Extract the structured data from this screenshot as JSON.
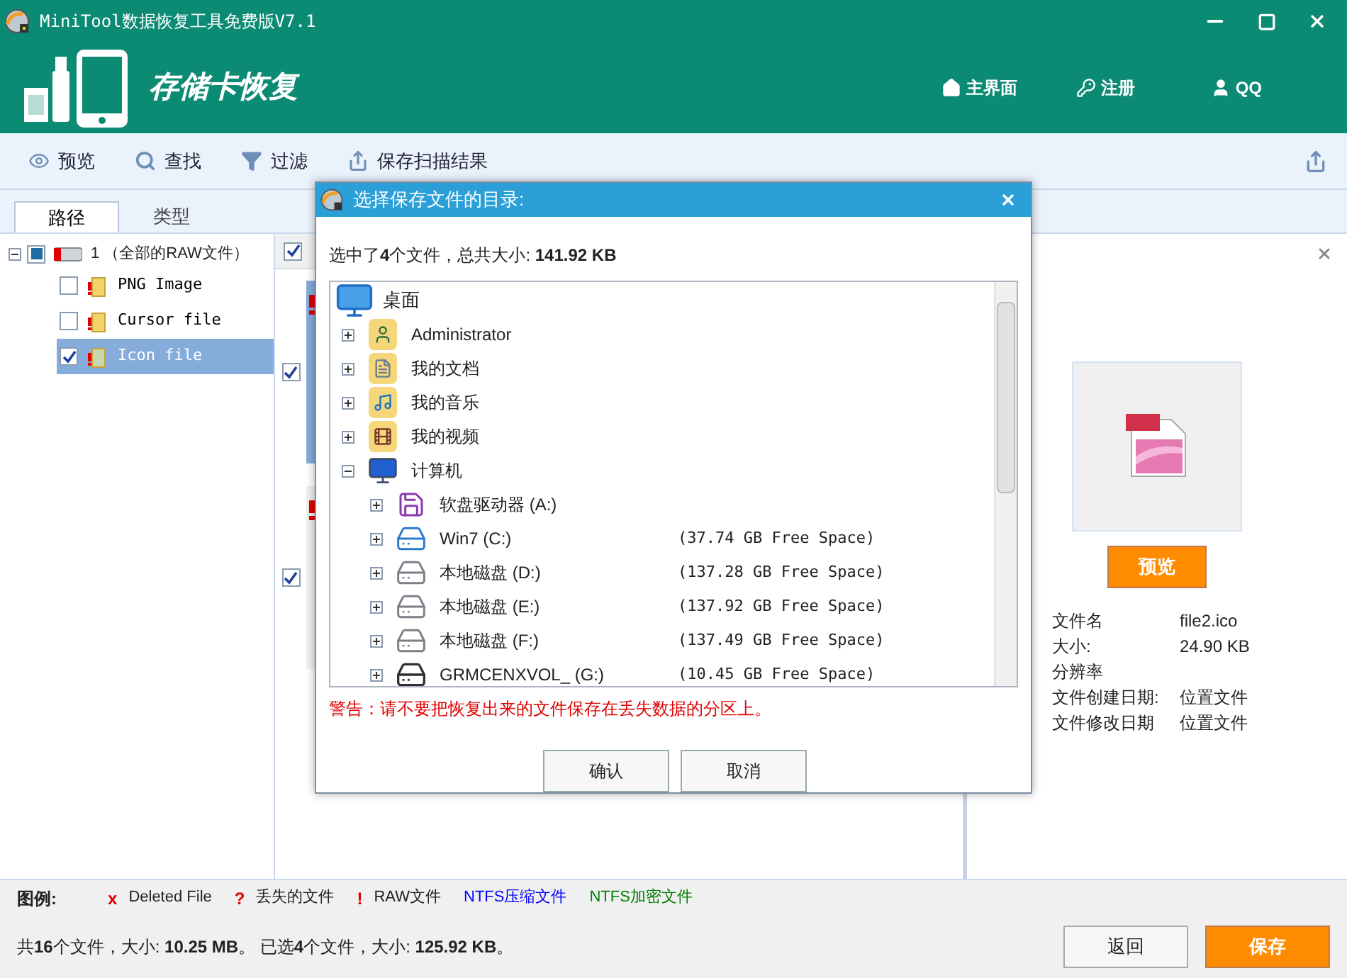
{
  "window": {
    "title": "MiniTool数据恢复工具免费版V7.1"
  },
  "header": {
    "title": "存储卡恢复",
    "nav": [
      "主界面",
      "注册",
      "QQ"
    ]
  },
  "toolbar": {
    "items": [
      "预览",
      "查找",
      "过滤",
      "保存扫描结果"
    ]
  },
  "tabs": [
    {
      "label": "路径",
      "selected": true
    },
    {
      "label": "类型",
      "selected": false
    }
  ],
  "tree": {
    "label": "1 （全部的RAW文件）",
    "expanded": true,
    "checked": false,
    "partial": true,
    "children": [
      {
        "label": "PNG Image",
        "checked": false,
        "selected": false
      },
      {
        "label": "Cursor file",
        "checked": false,
        "selected": false
      },
      {
        "label": "Icon file",
        "checked": true,
        "selected": true
      }
    ]
  },
  "file_list": {
    "header_checked": true,
    "items": [
      {
        "checked": true,
        "selected": true
      },
      {
        "checked": true,
        "selected": false
      }
    ]
  },
  "dialog": {
    "title": "选择保存文件的目录:",
    "summary": "选中了**4**个文件，总共大小: **141.92 KB**",
    "tree": {
      "label": "桌面",
      "kind": "desktop",
      "children": [
        {
          "label": "Administrator",
          "kind": "user-folder",
          "expanded": false
        },
        {
          "label": "我的文档",
          "kind": "folder",
          "expanded": false
        },
        {
          "label": "我的音乐",
          "kind": "music-folder",
          "expanded": false
        },
        {
          "label": "我的视频",
          "kind": "video-folder",
          "expanded": false
        },
        {
          "label": "计算机",
          "kind": "computer",
          "expanded": true,
          "children": [
            {
              "label": "软盘驱动器 (A:)",
              "kind": "floppy",
              "expanded": false
            },
            {
              "label": "Win7 (C:)",
              "kind": "system-drive",
              "expanded": false,
              "free": "(37.74 GB Free Space)"
            },
            {
              "label": "本地磁盘 (D:)",
              "kind": "drive",
              "expanded": false,
              "free": "(137.28 GB Free Space)"
            },
            {
              "label": "本地磁盘 (E:)",
              "kind": "drive",
              "expanded": false,
              "free": "(137.92 GB Free Space)"
            },
            {
              "label": "本地磁盘 (F:)",
              "kind": "drive",
              "expanded": false,
              "free": "(137.49 GB Free Space)"
            },
            {
              "label": "GRMCENXVOL_ (G:)",
              "kind": "usb-drive",
              "expanded": false,
              "free": "(10.45 GB Free Space)"
            }
          ]
        }
      ]
    },
    "warning": "警告：请不要把恢复出来的文件保存在丢失数据的分区上。",
    "buttons": [
      "确认",
      "取消"
    ]
  },
  "details": {
    "preview_button": "预览",
    "rows": [
      {
        "label": "文件名",
        "value": "file2.ico"
      },
      {
        "label": "大小:",
        "value": "24.90 KB"
      },
      {
        "label": "分辨率"
      },
      {
        "label": "文件创建日期:",
        "value": "位置文件"
      },
      {
        "label": "文件修改日期",
        "value": "位置文件"
      }
    ]
  },
  "legend": {
    "title": "图例:",
    "items": [
      {
        "kind": "mark",
        "mark": "x",
        "label": "Deleted File",
        "color": "#e00000"
      },
      {
        "kind": "mark",
        "mark": "?",
        "label": "丢失的文件",
        "color": "#e00000"
      },
      {
        "kind": "mark",
        "mark": "!",
        "label": "RAW文件",
        "color": "#e00000"
      },
      {
        "kind": "colored",
        "label": "NTFS压缩文件",
        "color": "#0000ff"
      },
      {
        "kind": "colored",
        "label": "NTFS加密文件",
        "color": "#008000"
      }
    ]
  },
  "status": "共**16**个文件，大小: **10.25 MB**。 已选**4**个文件，大小: **125.92 KB**。",
  "footer_buttons": [
    "返回",
    "保存"
  ]
}
